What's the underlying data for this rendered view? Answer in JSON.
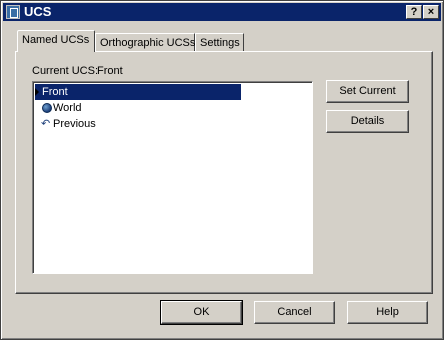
{
  "window": {
    "title": "UCS",
    "help_glyph": "?",
    "close_glyph": "×"
  },
  "tabs": [
    {
      "label": "Named UCSs",
      "active": true
    },
    {
      "label": "Orthographic UCSs",
      "active": false
    },
    {
      "label": "Settings",
      "active": false
    }
  ],
  "current_ucs": {
    "label": "Current UCS:",
    "value": "Front"
  },
  "ucs_list": {
    "items": [
      {
        "label": "Front",
        "icon": "current-arrow-icon",
        "selected": true
      },
      {
        "label": "World",
        "icon": "globe-icon",
        "selected": false
      },
      {
        "label": "Previous",
        "icon": "undo-arrow-icon",
        "selected": false
      }
    ]
  },
  "side_buttons": {
    "set_current": "Set Current",
    "details": "Details"
  },
  "footer_buttons": {
    "ok": "OK",
    "cancel": "Cancel",
    "help": "Help"
  },
  "colors": {
    "titlebar": "#0a246a",
    "selection": "#0a246a",
    "face": "#d4d0c8"
  }
}
